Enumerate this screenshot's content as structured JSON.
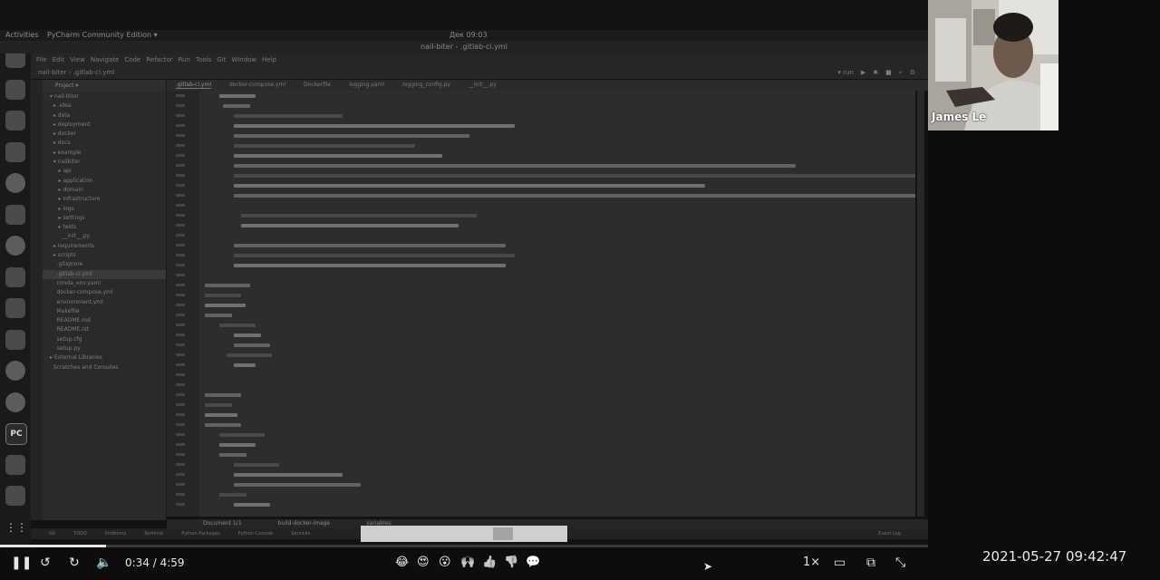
{
  "desktop": {
    "activities": "Activities",
    "app_menu": "PyCharm Community Edition ▾",
    "clock": "Дек 09:03"
  },
  "ide": {
    "window_title": "nail-biter - .gitlab-ci.yml",
    "menu": [
      "File",
      "Edit",
      "View",
      "Navigate",
      "Code",
      "Refactor",
      "Run",
      "Tools",
      "Git",
      "Window",
      "Help"
    ],
    "breadcrumb": "nail-biter  ›  .gitlab-ci.yml",
    "project_header": "Project ▾",
    "tree": [
      "▾ nail-biter",
      "  ▸ .idea",
      "  ▸ data",
      "  ▸ deployment",
      "  ▸ docker",
      "  ▸ docs",
      "  ▸ example",
      "  ▾ nailbiter",
      "     ▸ api",
      "     ▸ application",
      "     ▸ domain",
      "     ▸ infrastructure",
      "     ▸ logs",
      "     ▸ settings",
      "     ▸ tests",
      "       __init__.py",
      "  ▸ requirements",
      "  ▸ scripts",
      "    .gitignore",
      "    .gitlab-ci.yml",
      "    conda_env.yaml",
      "    docker-compose.yml",
      "    environment.yml",
      "    Makefile",
      "    README.md",
      "    README.rst",
      "    setup.cfg",
      "    setup.py",
      "▸ External Libraries",
      "  Scratches and Consoles"
    ],
    "tabs": [
      ".gitlab-ci.yml",
      "docker-compose.yml",
      "Dockerfile",
      "logging.yaml",
      "logging_config.py",
      "__init__.py"
    ],
    "bottom_tabs": [
      "Document 1/1",
      "build-docker-image",
      "variables"
    ],
    "status_items": [
      "Git",
      "TODO",
      "Problems",
      "Terminal",
      "Python Packages",
      "Python Console",
      "Services"
    ],
    "status_right": "Event Log",
    "run_config": "▾ run"
  },
  "webcam": {
    "participant_name": "James Le"
  },
  "player": {
    "current_time": "0:34",
    "duration": "4:59",
    "time_display": "0:34 / 4:59",
    "progress": 0.114,
    "speed": "1×",
    "reactions": [
      "😂",
      "😍",
      "😮",
      "🙌",
      "👍",
      "👎",
      "💬"
    ]
  },
  "overlay": {
    "datetime": "2021-05-27  09:42:47"
  }
}
